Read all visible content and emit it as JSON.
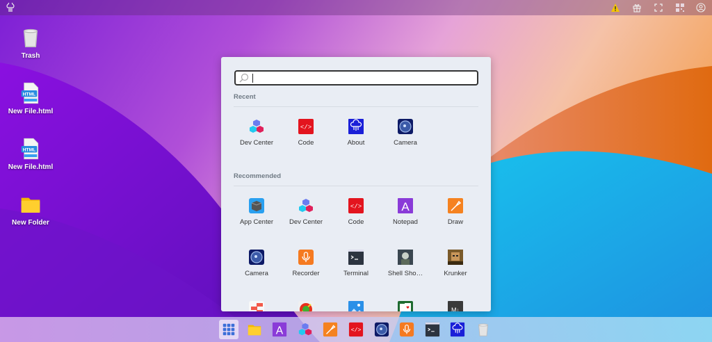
{
  "topbar": {
    "icons": [
      "logo-icon",
      "warning-icon",
      "gift-icon",
      "fullscreen-icon",
      "qr-code-icon",
      "user-icon"
    ],
    "warning_color": "#f5c400"
  },
  "desktop": [
    {
      "label": "Trash",
      "icon": "trash"
    },
    {
      "label": "New File.html",
      "icon": "html"
    },
    {
      "label": "New File.html",
      "icon": "html"
    },
    {
      "label": "New Folder",
      "icon": "folder"
    }
  ],
  "menu": {
    "search": {
      "value": "",
      "placeholder": ""
    },
    "recent_label": "Recent",
    "recent": [
      {
        "label": "Dev Center",
        "icon": "cubes"
      },
      {
        "label": "Code",
        "icon": "code"
      },
      {
        "label": "About",
        "icon": "about"
      },
      {
        "label": "Camera",
        "icon": "camera"
      }
    ],
    "recommended_label": "Recommended",
    "recommended": [
      {
        "label": "App Center",
        "icon": "appcenter"
      },
      {
        "label": "Dev Center",
        "icon": "cubes"
      },
      {
        "label": "Code",
        "icon": "code"
      },
      {
        "label": "Notepad",
        "icon": "notepad"
      },
      {
        "label": "Draw",
        "icon": "draw"
      },
      {
        "label": "Camera",
        "icon": "camera"
      },
      {
        "label": "Recorder",
        "icon": "recorder"
      },
      {
        "label": "Terminal",
        "icon": "terminal"
      },
      {
        "label": "Shell Sho…",
        "icon": "shell"
      },
      {
        "label": "Krunker",
        "icon": "krunker"
      },
      {
        "label": "",
        "icon": "tetris"
      },
      {
        "label": "",
        "icon": "fruit"
      },
      {
        "label": "",
        "icon": "photos"
      },
      {
        "label": "",
        "icon": "cards"
      },
      {
        "label": "",
        "icon": "markdown"
      }
    ]
  },
  "taskbar": [
    {
      "name": "app-launcher",
      "icon": "grid",
      "active": true
    },
    {
      "name": "files",
      "icon": "folder"
    },
    {
      "name": "notepad",
      "icon": "notepad"
    },
    {
      "name": "dev-center",
      "icon": "cubes"
    },
    {
      "name": "draw",
      "icon": "draw"
    },
    {
      "name": "code",
      "icon": "code"
    },
    {
      "name": "camera",
      "icon": "camera"
    },
    {
      "name": "recorder",
      "icon": "recorder"
    },
    {
      "name": "terminal",
      "icon": "terminal"
    },
    {
      "name": "about",
      "icon": "about"
    },
    {
      "name": "trash",
      "icon": "trash"
    }
  ]
}
